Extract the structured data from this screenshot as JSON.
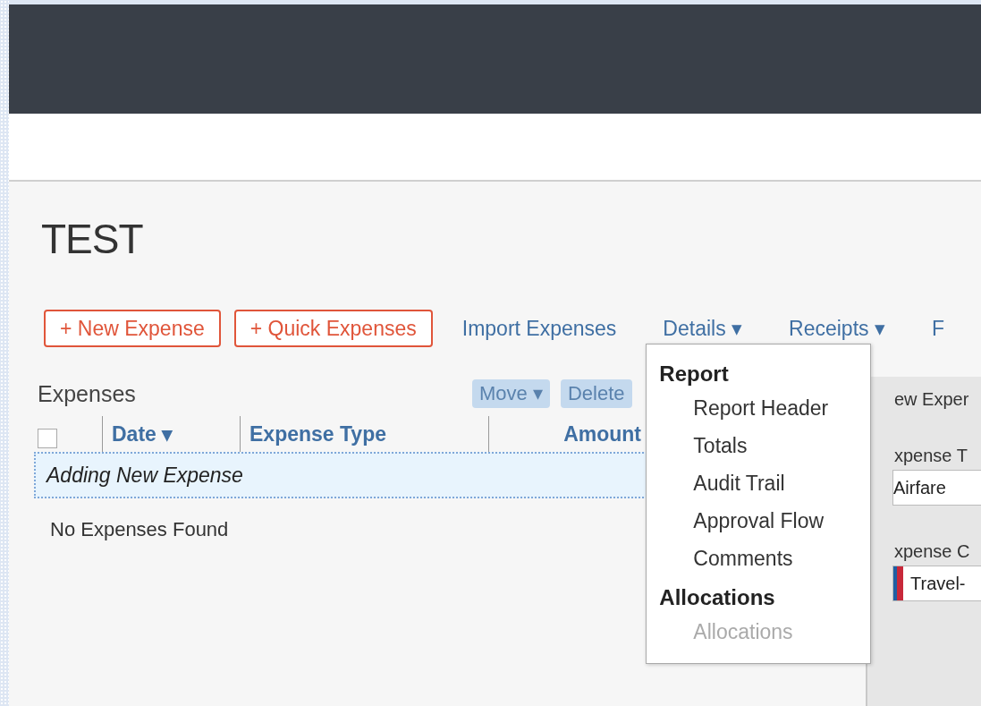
{
  "page": {
    "title": "TEST"
  },
  "toolbar": {
    "buttons": [
      {
        "label": "+ New Expense"
      },
      {
        "label": "+ Quick Expenses"
      }
    ],
    "links": [
      {
        "label": "Import Expenses"
      },
      {
        "label": "Details ▾",
        "menu": {
          "sections": [
            {
              "heading": "Report",
              "items": [
                {
                  "label": "Report Header",
                  "disabled": false
                },
                {
                  "label": "Totals",
                  "disabled": false
                },
                {
                  "label": "Audit Trail",
                  "disabled": false
                },
                {
                  "label": "Approval Flow",
                  "disabled": false
                },
                {
                  "label": "Comments",
                  "disabled": false
                }
              ]
            },
            {
              "heading": "Allocations",
              "items": [
                {
                  "label": "Allocations",
                  "disabled": true
                }
              ]
            }
          ]
        }
      },
      {
        "label": "Receipts ▾"
      },
      {
        "label": "F"
      }
    ]
  },
  "expenses": {
    "heading": "Expenses",
    "actions": [
      {
        "label": "Move ▾",
        "disabled": true
      },
      {
        "label": "Delete",
        "disabled": true
      }
    ],
    "select_all": {
      "checked": false
    },
    "columns": [
      "Date ▾",
      "Expense Type",
      "Amount"
    ],
    "adding_row": "Adding New Expense",
    "empty_message": "No Expenses Found"
  },
  "side_panel": {
    "title": "ew Exper",
    "fields": [
      {
        "label": "xpense T",
        "value": "Airfare",
        "kind": "plain"
      },
      {
        "label": "xpense C",
        "value": "Travel-",
        "kind": "flagged"
      }
    ]
  }
}
